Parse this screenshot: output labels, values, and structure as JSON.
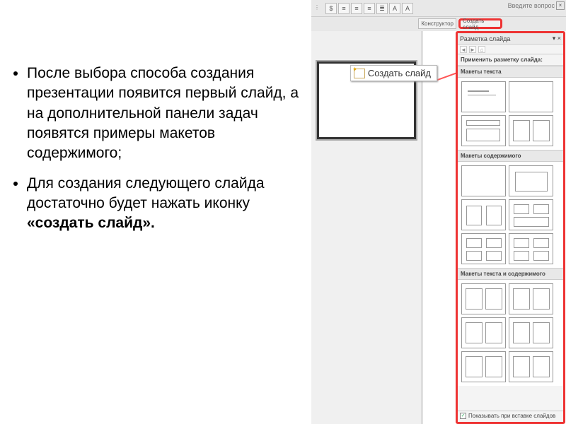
{
  "slide": {
    "bullets": [
      "После выбора способа создания презентации появится первый слайд, а на дополнительной панели задач появятся примеры макетов содержимого;",
      "Для создания следующего слайда достаточно будет нажать иконку "
    ],
    "bold_tail": "«создать слайд»."
  },
  "powerpoint": {
    "question_box": "Введите вопрос",
    "menu_constructor": "Конструктор",
    "menu_create_slide": "Создать слайд",
    "callout_button": "Создать слайд",
    "task_pane_title": "Разметка слайда",
    "apply_label": "Применить разметку слайда:",
    "sections": {
      "text_layouts": "Макеты текста",
      "content_layouts": "Макеты содержимого",
      "text_content_layouts": "Макеты текста и содержимого"
    },
    "footer_checkbox": "Показывать при вставке слайдов"
  }
}
